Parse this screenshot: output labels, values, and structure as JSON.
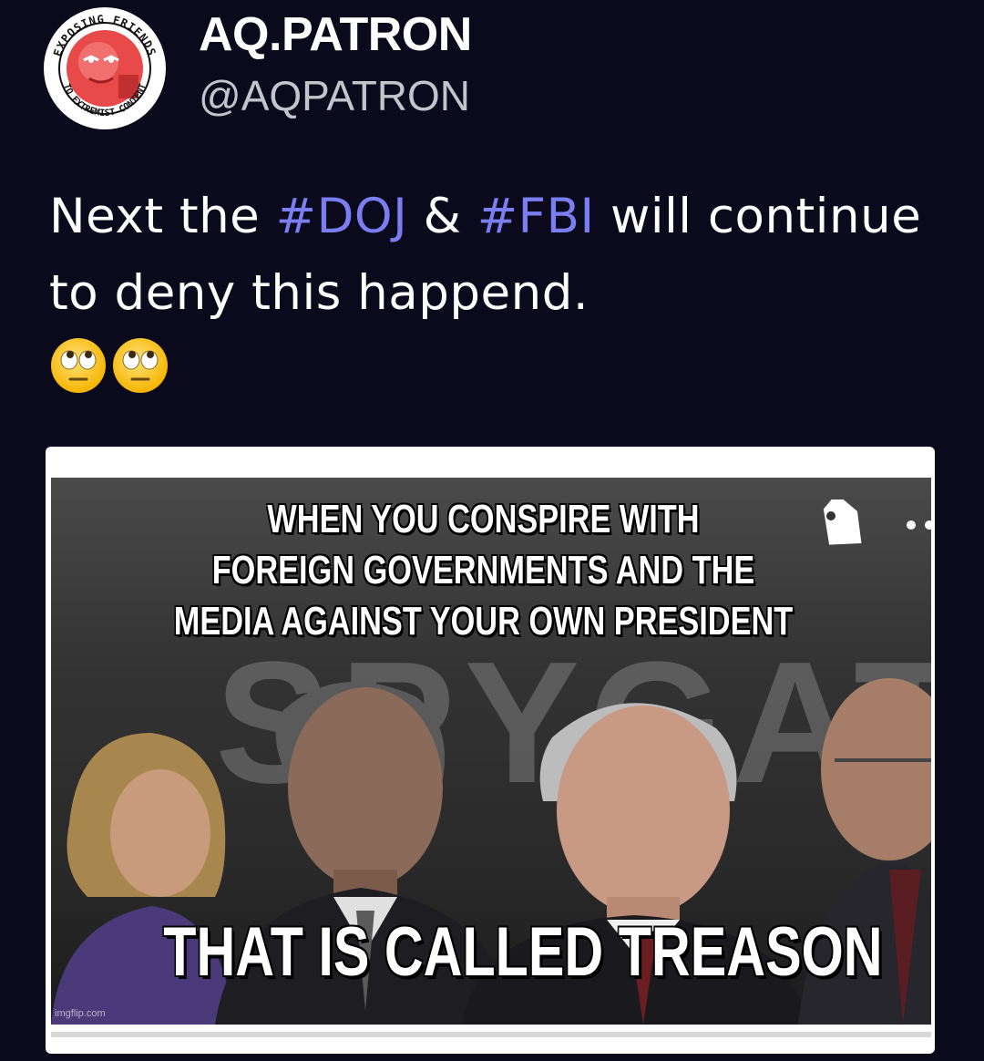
{
  "author": {
    "display_name": "AQ.PATRON",
    "handle": "@AQPATRON",
    "avatar_badge_text": {
      "top": "EXPOSING FRIENDS",
      "bottom": "TO EXTREMIST CONTENT"
    }
  },
  "post": {
    "text_before": "Next the ",
    "hashtag_1": "#DOJ",
    "text_middle": " & ",
    "hashtag_2": "#FBI",
    "text_after": " will continue to deny this happend.",
    "emojis": [
      "face-with-rolling-eyes",
      "face-with-rolling-eyes"
    ]
  },
  "media": {
    "caption_top_lines": [
      "WHEN YOU CONSPIRE WITH",
      "FOREIGN GOVERNMENTS AND THE",
      "MEDIA AGAINST YOUR OWN PRESIDENT"
    ],
    "background_word": "SPYGATE",
    "caption_bottom": "THAT IS CALLED TREASON",
    "watermark": "imgflip.com"
  },
  "colors": {
    "background": "#0b0a1c",
    "hashtag": "#7b7ef0",
    "handle": "#c4c4cc",
    "text": "#ffffff"
  }
}
